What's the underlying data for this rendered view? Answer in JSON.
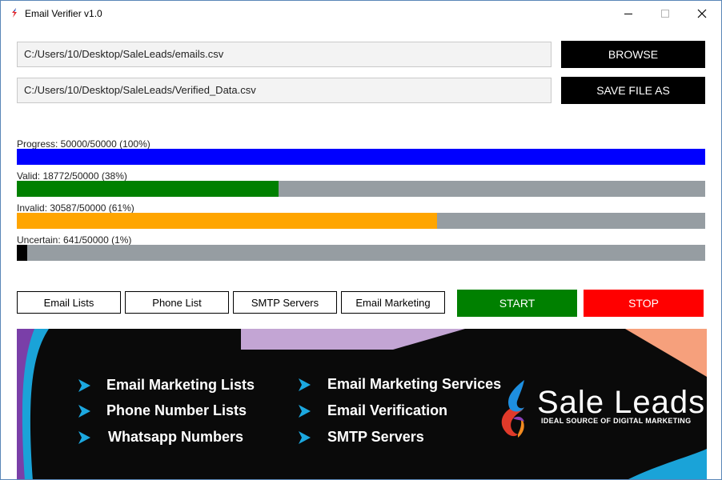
{
  "window": {
    "title": "Email Verifier v1.0"
  },
  "files": {
    "input_path": "C:/Users/10/Desktop/SaleLeads/emails.csv",
    "output_path": "C:/Users/10/Desktop/SaleLeads/Verified_Data.csv",
    "browse_label": "BROWSE",
    "save_label": "SAVE FILE AS"
  },
  "stats": [
    {
      "label": "Progress: 50000/50000 (100%)",
      "fraction": 1.0,
      "color": "#0000ff"
    },
    {
      "label": "Valid: 18772/50000 (38%)",
      "fraction": 0.38,
      "color": "#008000"
    },
    {
      "label": "Invalid: 30587/50000 (61%)",
      "fraction": 0.61,
      "color": "#ffa500"
    },
    {
      "label": "Uncertain: 641/50000 (1%)",
      "fraction": 0.015,
      "color": "#000000"
    }
  ],
  "nav": {
    "email_lists": "Email Lists",
    "phone_list": "Phone List",
    "smtp_servers": "SMTP Servers",
    "email_marketing": "Email Marketing"
  },
  "actions": {
    "start": "START",
    "stop": "STOP",
    "start_color": "#008000",
    "stop_color": "#ff0000"
  },
  "banner": {
    "left_items": [
      "Email Marketing Lists",
      "Phone Number Lists",
      "Whatsapp Numbers"
    ],
    "right_items": [
      "Email Marketing Services",
      "Email Verification",
      "SMTP Servers"
    ],
    "brand": "Sale Leads",
    "tagline": "IDEAL SOURCE OF DIGITAL MARKETING"
  }
}
